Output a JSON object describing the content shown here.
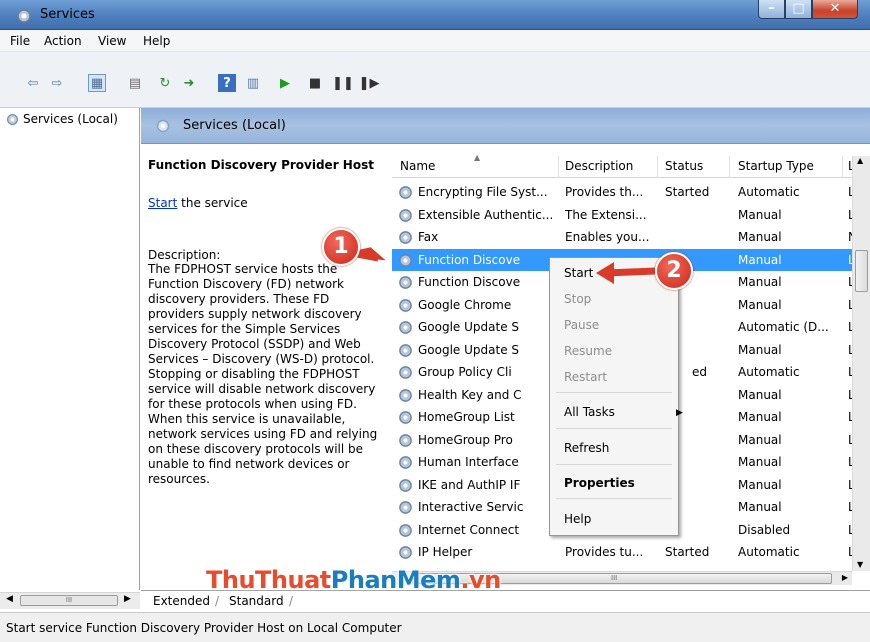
{
  "window": {
    "title": "Services"
  },
  "menu": [
    "File",
    "Action",
    "View",
    "Help"
  ],
  "tree": {
    "root": "Services (Local)"
  },
  "pane_header": "Services (Local)",
  "detail": {
    "title": "Function Discovery Provider Host",
    "start_link": "Start",
    "start_suffix": " the service",
    "description_label": "Description:",
    "description_lines": [
      "The FDPHOST service hosts the",
      "Function Discovery (FD) network",
      "discovery providers. These FD",
      "providers supply network discovery",
      "services for the Simple Services",
      "Discovery Protocol (SSDP) and Web",
      "Services – Discovery (WS-D) protocol.",
      "Stopping or disabling the FDPHOST",
      "service will disable network discovery",
      "for these protocols when using FD.",
      "When this service is unavailable,",
      "network services using FD and relying",
      "on these discovery protocols will be",
      "unable to find network devices or",
      "resources."
    ]
  },
  "columns": [
    "Name",
    "Description",
    "Status",
    "Startup Type",
    "L"
  ],
  "rows": [
    {
      "name": "Encrypting File Syst...",
      "desc": "Provides th...",
      "status": "Started",
      "startup": "Automatic",
      "logon": "L"
    },
    {
      "name": "Extensible Authentic...",
      "desc": "The Extensi...",
      "status": "",
      "startup": "Manual",
      "logon": "L"
    },
    {
      "name": "Fax",
      "desc": "Enables you...",
      "status": "",
      "startup": "Manual",
      "logon": "N"
    },
    {
      "name": "Function Discove",
      "desc": "",
      "status": "",
      "startup": "Manual",
      "logon": "L"
    },
    {
      "name": "Function Discove",
      "desc": "",
      "status": "",
      "startup": "Manual",
      "logon": "L"
    },
    {
      "name": "Google Chrome",
      "desc": "",
      "status": "",
      "startup": "Manual",
      "logon": "L"
    },
    {
      "name": "Google Update S",
      "desc": "",
      "status": "",
      "startup": "Automatic (D...",
      "logon": "L"
    },
    {
      "name": "Google Update S",
      "desc": "",
      "status": "",
      "startup": "Manual",
      "logon": "L"
    },
    {
      "name": "Group Policy Cli",
      "desc": "",
      "status": "ed",
      "startup": "Automatic",
      "logon": "L"
    },
    {
      "name": "Health Key and C",
      "desc": "",
      "status": "",
      "startup": "Manual",
      "logon": "L"
    },
    {
      "name": "HomeGroup List",
      "desc": "",
      "status": "",
      "startup": "Manual",
      "logon": "L"
    },
    {
      "name": "HomeGroup Pro",
      "desc": "",
      "status": "",
      "startup": "Manual",
      "logon": "L"
    },
    {
      "name": "Human Interface",
      "desc": "",
      "status": "",
      "startup": "Manual",
      "logon": "L"
    },
    {
      "name": "IKE and AuthIP IF",
      "desc": "",
      "status": "",
      "startup": "Manual",
      "logon": "L"
    },
    {
      "name": "Interactive Servic",
      "desc": "",
      "status": "",
      "startup": "Manual",
      "logon": "L"
    },
    {
      "name": "Internet Connect",
      "desc": "",
      "status": "",
      "startup": "Disabled",
      "logon": "L"
    },
    {
      "name": "IP Helper",
      "desc": "Provides tu...",
      "status": "Started",
      "startup": "Automatic",
      "logon": "L"
    }
  ],
  "context_menu": {
    "start": "Start",
    "stop": "Stop",
    "pause": "Pause",
    "resume": "Resume",
    "restart": "Restart",
    "all_tasks": "All Tasks",
    "refresh": "Refresh",
    "properties": "Properties",
    "help": "Help"
  },
  "annotations": {
    "badge1": "1",
    "badge2": "2"
  },
  "tabs": {
    "extended": "Extended",
    "standard": "Standard"
  },
  "status_text": "Start service Function Discovery Provider Host on Local Computer",
  "scrollbar_glyph": "III",
  "watermark": {
    "part1": "ThuThuat",
    "part2": "PhanMem",
    "part3": ".vn"
  },
  "colors": {
    "selection": "#3399ff",
    "badge": "#d83b2c",
    "link": "#0033cc"
  }
}
